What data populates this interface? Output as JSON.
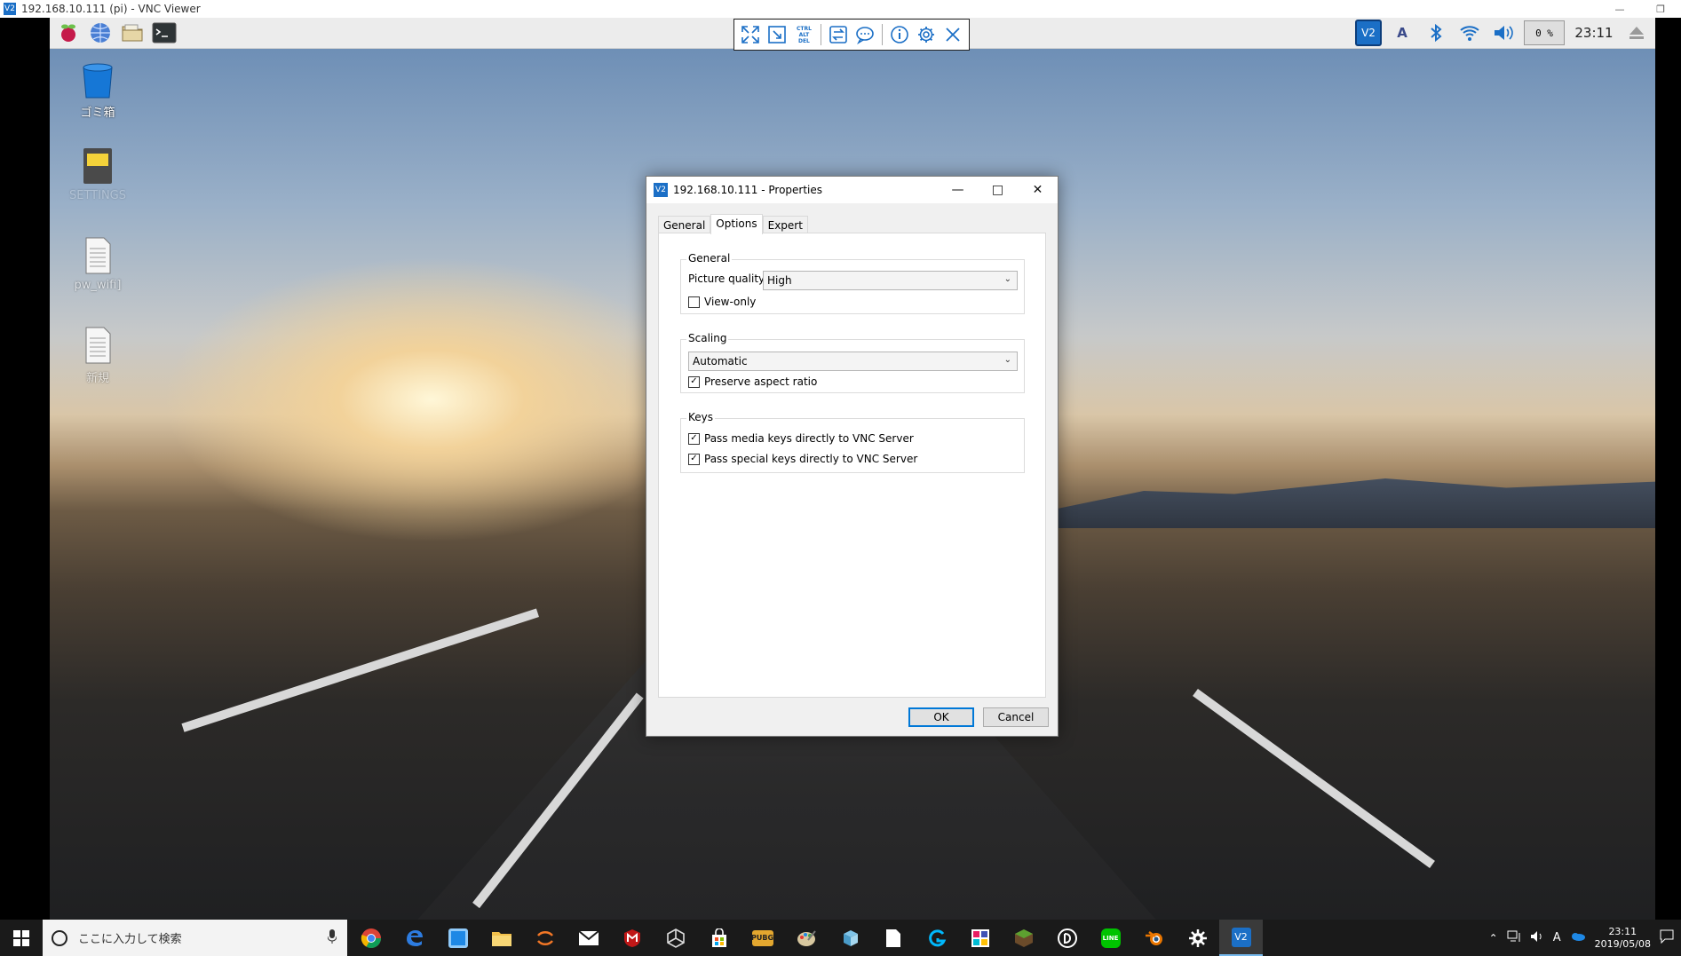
{
  "viewer": {
    "title": "192.168.10.111 (pi) - VNC Viewer",
    "logo_text": "V2"
  },
  "rpi_panel": {
    "cpu": "0 %",
    "clock": "23:11"
  },
  "vnc_toolbar": {
    "ctrl_alt_del": "CTRL\nALT\nDEL"
  },
  "desktop": {
    "icons": [
      {
        "label": "ゴミ箱"
      },
      {
        "label": "SETTINGS"
      },
      {
        "label": "pw_wifi]"
      },
      {
        "label": "新規"
      }
    ]
  },
  "dialog": {
    "title": "192.168.10.111 - Properties",
    "tabs": [
      "General",
      "Options",
      "Expert"
    ],
    "active_tab": "Options",
    "groups": {
      "general": {
        "legend": "General",
        "picture_quality_label": "Picture quality:",
        "picture_quality_value": "High",
        "view_only_label": "View-only",
        "view_only_checked": false
      },
      "scaling": {
        "legend": "Scaling",
        "scaling_value": "Automatic",
        "preserve_label": "Preserve aspect ratio",
        "preserve_checked": true
      },
      "keys": {
        "legend": "Keys",
        "media_keys_label": "Pass media keys directly to VNC Server",
        "media_keys_checked": true,
        "special_keys_label": "Pass special keys directly to VNC Server",
        "special_keys_checked": true
      }
    },
    "ok_label": "OK",
    "cancel_label": "Cancel"
  },
  "taskbar": {
    "search_placeholder": "ここに入力して検索",
    "time": "23:11",
    "date": "2019/05/08",
    "ime": "A"
  },
  "colors": {
    "accent": "#0078d7",
    "vnc_blue": "#1b6fc6"
  }
}
